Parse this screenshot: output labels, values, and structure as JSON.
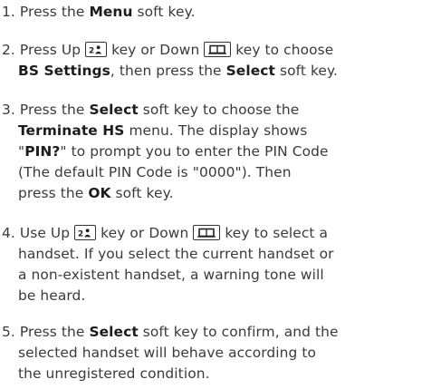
{
  "steps": [
    {
      "num": "1.",
      "parts": [
        "Press the ",
        "Menu",
        " soft key."
      ]
    },
    {
      "num": "2.",
      "parts": [
        "Press Up ",
        " key or Down ",
        " key to choose",
        "BS Settings",
        ", then press the ",
        "Select",
        " soft key."
      ]
    },
    {
      "num": "3.",
      "parts": [
        "Press the ",
        "Select",
        " soft key to choose the",
        "Terminate HS",
        " menu. The display shows",
        "\"",
        "PIN?",
        "\" to prompt you to enter the PIN Code",
        "(The default PIN Code is \"0000\"). Then",
        "press the ",
        "OK",
        " soft key."
      ]
    },
    {
      "num": "4.",
      "parts": [
        "Use Up ",
        " key or Down ",
        " key to select a",
        "handset. If you select the current handset or",
        "a non-existent handset, a warning tone will",
        "be heard."
      ]
    },
    {
      "num": "5.",
      "parts": [
        "Press the ",
        "Select",
        " soft key to confirm, and the",
        "selected handset will behave according to",
        "the unregistered condition."
      ]
    }
  ],
  "icons": {
    "up_key": "up-key-icon",
    "down_key": "down-key-icon"
  }
}
